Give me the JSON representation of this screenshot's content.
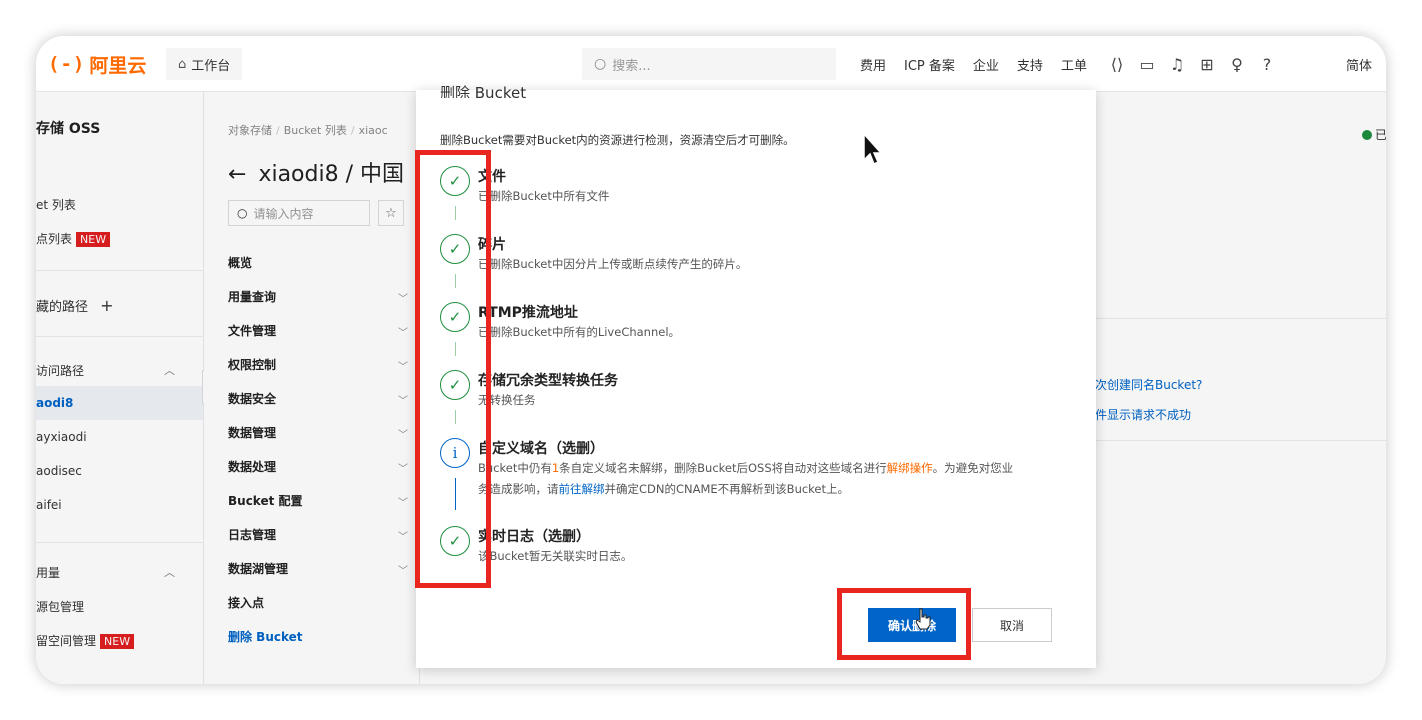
{
  "topbar": {
    "logo_mark": "(-)",
    "logo_name": "阿里云",
    "workbench": "工作台",
    "search_placeholder": "搜索...",
    "nav": [
      "费用",
      "ICP 备案",
      "企业",
      "支持",
      "工单"
    ],
    "icons": [
      "code-icon",
      "terminal-icon",
      "bell-icon",
      "cart-icon",
      "lightbulb-icon",
      "help-icon"
    ],
    "language": "简体"
  },
  "sidebar": {
    "title": "存储 OSS",
    "bucket_list": "et 列表",
    "endpoint_list": "点列表",
    "new_badge": "NEW",
    "fav_paths": "藏的路径",
    "add": "+",
    "recent_paths": "访问路径",
    "buckets": [
      "aodi8",
      "ayxiaodi",
      "aodisec",
      "aifei"
    ],
    "usage": "用量",
    "resource_pkg": "源包管理",
    "reserved_space": "留空间管理",
    "new_badge2": "NEW"
  },
  "bucket_menu": {
    "crumb": [
      "对象存储",
      "Bucket 列表",
      "xiaoc"
    ],
    "title": "xiaodi8 / 中国",
    "search_placeholder": "请输入内容",
    "items": [
      {
        "label": "概览",
        "chevron": false
      },
      {
        "label": "用量查询",
        "chevron": true
      },
      {
        "label": "文件管理",
        "chevron": true
      },
      {
        "label": "权限控制",
        "chevron": true
      },
      {
        "label": "数据安全",
        "chevron": true
      },
      {
        "label": "数据管理",
        "chevron": true
      },
      {
        "label": "数据处理",
        "chevron": true
      },
      {
        "label": "Bucket 配置",
        "chevron": true
      },
      {
        "label": "日志管理",
        "chevron": true
      },
      {
        "label": "数据湖管理",
        "chevron": true
      },
      {
        "label": "接入点",
        "chevron": false
      },
      {
        "label": "删除 Bucket",
        "chevron": false
      }
    ]
  },
  "content": {
    "status": "已",
    "faq1": "次创建同名Bucket?",
    "faq2": "件显示请求不成功"
  },
  "modal": {
    "title": "删除 Bucket",
    "description": "删除Bucket需要对Bucket内的资源进行检测，资源清空后才可删除。",
    "steps": [
      {
        "title": "文件",
        "desc": "已删除Bucket中所有文件",
        "status": "done"
      },
      {
        "title": "碎片",
        "desc": "已删除Bucket中因分片上传或断点续传产生的碎片。",
        "status": "done"
      },
      {
        "title": "RTMP推流地址",
        "desc": "已删除Bucket中所有的LiveChannel。",
        "status": "done"
      },
      {
        "title": "存储冗余类型转换任务",
        "desc": "无转换任务",
        "status": "done"
      },
      {
        "title": "自定义域名（选删）",
        "status": "info",
        "desc_line1_pre": "Bucket中仍有",
        "desc_count": "1",
        "desc_line1_mid": "条自定义域名未解绑，删除Bucket后OSS将自动对这些域名进行",
        "desc_link1": "解绑操作",
        "desc_line1_post": "。为避免对您业",
        "desc_line2_pre": "务造成影响，请",
        "desc_link2": "前往解绑",
        "desc_line2_post": "并确定CDN的CNAME不再解析到该Bucket上。"
      },
      {
        "title": "实时日志（选删）",
        "desc": "该Bucket暂无关联实时日志。",
        "status": "done"
      }
    ],
    "confirm": "确认删除",
    "cancel": "取消"
  },
  "colors": {
    "brand": "#ff6a00",
    "primary": "#0064c8",
    "success": "#1e8e3e",
    "annotation": "#e8251e"
  }
}
